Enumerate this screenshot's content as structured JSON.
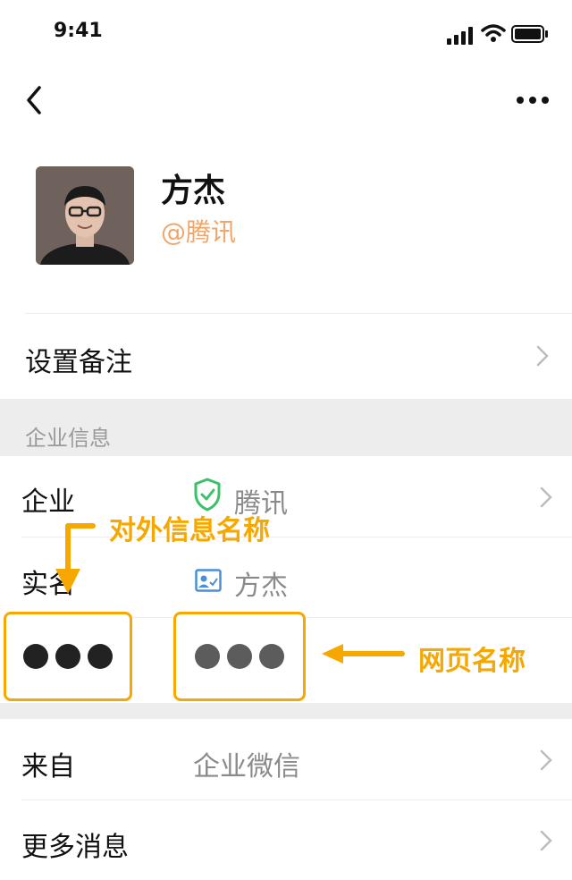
{
  "status_bar": {
    "time": "9:41"
  },
  "profile": {
    "name": "方杰",
    "company": "@腾讯"
  },
  "remark": {
    "label": "设置备注"
  },
  "enterprise_section": {
    "title": "企业信息"
  },
  "rows": {
    "company": {
      "label": "企业",
      "value": "腾讯"
    },
    "real_name": {
      "label": "实名",
      "value": "方杰"
    },
    "from": {
      "label": "来自",
      "value": "企业微信"
    },
    "more_info": {
      "label": "更多消息"
    }
  },
  "annotations": {
    "external_info_name": "对外信息名称",
    "web_page_name": "网页名称"
  },
  "colors": {
    "accent_orange": "#f6a800",
    "company_tag": "#f0a66b",
    "verified_green": "#3cc16b",
    "realname_blue": "#4a8fd8"
  }
}
